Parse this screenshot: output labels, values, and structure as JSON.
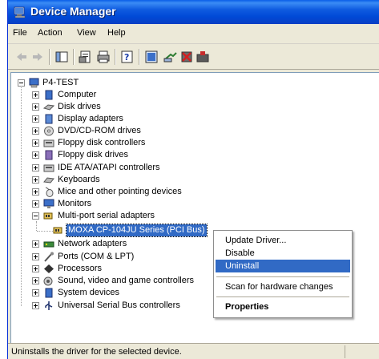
{
  "window": {
    "title": "Device Manager"
  },
  "menubar": {
    "items": [
      "File",
      "Action",
      "View",
      "Help"
    ]
  },
  "toolbar": {
    "buttons": [
      "back-icon",
      "forward-icon",
      "show-hide-tree-icon",
      "properties-icon",
      "print-icon",
      "help-icon",
      "view-icon",
      "scan-hardware-icon",
      "uninstall-icon",
      "update-driver-icon"
    ]
  },
  "tree": {
    "root": "P4-TEST",
    "categories": [
      "Computer",
      "Disk drives",
      "Display adapters",
      "DVD/CD-ROM drives",
      "Floppy disk controllers",
      "Floppy disk drives",
      "IDE ATA/ATAPI controllers",
      "Keyboards",
      "Mice and other pointing devices",
      "Monitors",
      "Multi-port serial adapters",
      "Network adapters",
      "Ports (COM & LPT)",
      "Processors",
      "Sound, video and game controllers",
      "System devices",
      "Universal Serial Bus controllers"
    ],
    "selected_device": "MOXA CP-104JU Series (PCI Bus)"
  },
  "context_menu": {
    "items": [
      "Update Driver...",
      "Disable",
      "Uninstall",
      "Scan for hardware changes",
      "Properties"
    ],
    "highlighted": "Uninstall"
  },
  "statusbar": {
    "text": "Uninstalls the driver for the selected device."
  },
  "colors": {
    "titlebar": "#0049d6",
    "selection": "#316ac5",
    "chrome": "#ece9d8"
  }
}
